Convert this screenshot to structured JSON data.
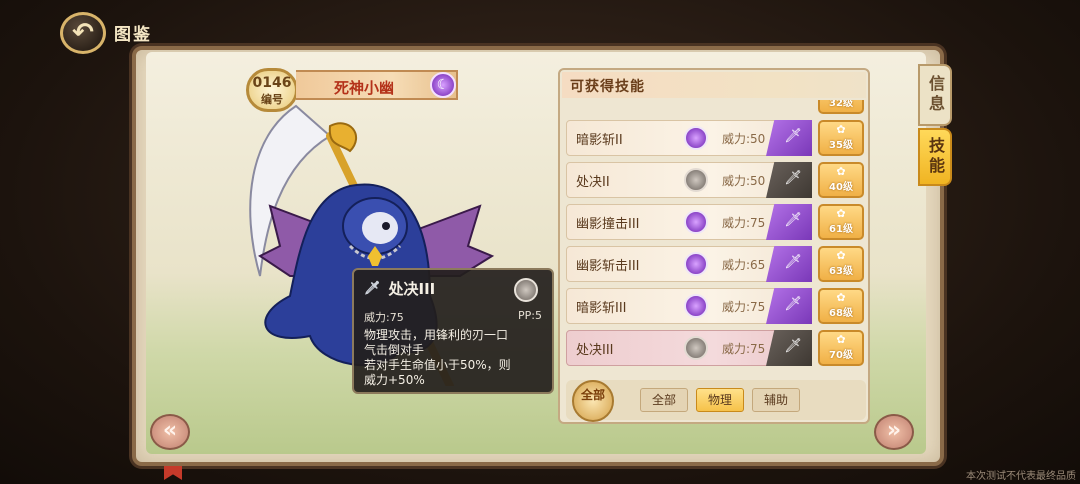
{
  "header": {
    "back_icon": "back-arrow-icon",
    "title": "图鉴"
  },
  "tabs": [
    {
      "label": "信息",
      "active": false
    },
    {
      "label": "技能",
      "active": true
    }
  ],
  "creature": {
    "number": "0146",
    "number_label": "编号",
    "name": "死神小幽",
    "type_icon": "ghost-type-icon"
  },
  "tooltip": {
    "skill_name": "处决III",
    "power": "威力:75",
    "pp": "PP:5",
    "description_1": "物理攻击，用锋利的刃一口",
    "description_2": "气击倒对手",
    "description_3": "若对手生命值小于50%，则",
    "description_4": "威力+50%"
  },
  "skills": {
    "header": "可获得技能",
    "partial_top": {
      "level": "32级"
    },
    "rows": [
      {
        "name": "暗影斩II",
        "type": "ghost",
        "power": "威力:50",
        "category": "ghost",
        "level": "35级"
      },
      {
        "name": "处决II",
        "type": "normal",
        "power": "威力:50",
        "category": "normal",
        "level": "40级"
      },
      {
        "name": "幽影撞击III",
        "type": "ghost",
        "power": "威力:75",
        "category": "ghost",
        "level": "61级"
      },
      {
        "name": "幽影斩击III",
        "type": "ghost",
        "power": "威力:65",
        "category": "ghost",
        "level": "63级"
      },
      {
        "name": "暗影斩III",
        "type": "ghost",
        "power": "威力:75",
        "category": "ghost",
        "level": "68级"
      },
      {
        "name": "处决III",
        "type": "normal",
        "power": "威力:75",
        "category": "normal",
        "level": "70级",
        "selected": true
      }
    ]
  },
  "filters": {
    "all_icon_label": "全部",
    "buttons": [
      {
        "label": "全部",
        "active": false
      },
      {
        "label": "物理",
        "active": true
      },
      {
        "label": "辅助",
        "active": false
      }
    ]
  },
  "watermark": "本次测试不代表最终品质",
  "colors": {
    "ghost": "#7a38b8",
    "accent": "#f0b422",
    "selected_row": "#f4dadc"
  }
}
